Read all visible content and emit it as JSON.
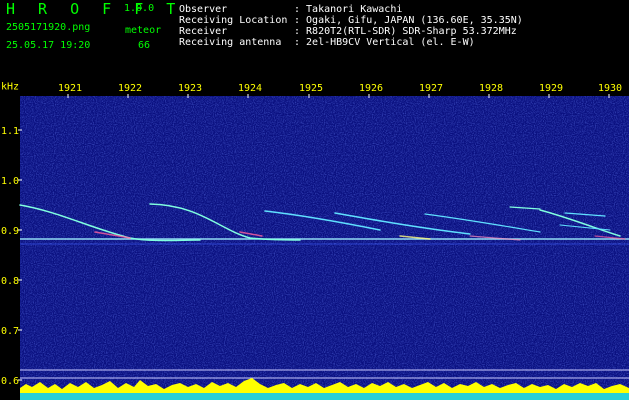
{
  "app": {
    "logo": "H R O F F T",
    "version": "1.0.0"
  },
  "file": {
    "name": "2505171920.png",
    "datetime": "25.05.17 19:20"
  },
  "meteor": {
    "label": "meteor",
    "count": "66"
  },
  "info": [
    {
      "key": "Observer",
      "value": ": Takanori Kawachi"
    },
    {
      "key": "Receiving Location",
      "value": ": Ogaki, Gifu, JAPAN (136.60E, 35.35N)"
    },
    {
      "key": "Receiver",
      "value": ": R820T2(RTL-SDR) SDR-Sharp 53.372MHz"
    },
    {
      "key": "Receiving antenna",
      "value": ": 2el-HB9CV Vertical (el. E-W)"
    }
  ],
  "axis": {
    "unit": "kHz",
    "time_ticks": [
      "1921",
      "1922",
      "1923",
      "1924",
      "1925",
      "1926",
      "1927",
      "1928",
      "1929",
      "1930"
    ],
    "freq_ticks": [
      "1.1",
      "1.0",
      "0.9",
      "0.8",
      "0.7",
      "0.6"
    ]
  },
  "colors": {
    "label": "#ffff00",
    "header_green": "#00ff00",
    "carrier": "#9ff0ff",
    "background": "#0a1080",
    "activity": "#ffff00"
  }
}
